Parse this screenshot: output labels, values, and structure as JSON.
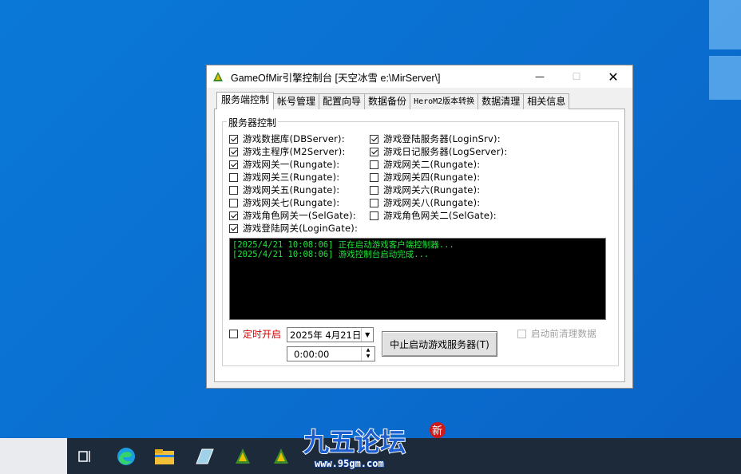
{
  "window": {
    "title": "GameOfMir引擎控制台 [天空冰雪 e:\\MirServer\\]",
    "minimize": "—",
    "maximize": "☐",
    "close": "✕"
  },
  "tabs": [
    {
      "label": "服务端控制"
    },
    {
      "label": "帐号管理"
    },
    {
      "label": "配置向导"
    },
    {
      "label": "数据备份"
    },
    {
      "label": "HeroM2版本转换"
    },
    {
      "label": "数据清理"
    },
    {
      "label": "相关信息"
    }
  ],
  "group": {
    "title": "服务器控制"
  },
  "left_checks": [
    {
      "label": "游戏数据库(DBServer):",
      "checked": true
    },
    {
      "label": "游戏主程序(M2Server):",
      "checked": true
    },
    {
      "label": "游戏网关一(Rungate):",
      "checked": true
    },
    {
      "label": "游戏网关三(Rungate):",
      "checked": false
    },
    {
      "label": "游戏网关五(Rungate):",
      "checked": false
    },
    {
      "label": "游戏网关七(Rungate):",
      "checked": false
    },
    {
      "label": "游戏角色网关一(SelGate):",
      "checked": true
    },
    {
      "label": "游戏登陆网关(LoginGate):",
      "checked": true
    }
  ],
  "right_checks": [
    {
      "label": "游戏登陆服务器(LoginSrv):",
      "checked": true
    },
    {
      "label": "游戏日记服务器(LogServer):",
      "checked": true
    },
    {
      "label": "游戏网关二(Rungate):",
      "checked": false
    },
    {
      "label": "游戏网关四(Rungate):",
      "checked": false
    },
    {
      "label": "游戏网关六(Rungate):",
      "checked": false
    },
    {
      "label": "游戏网关八(Rungate):",
      "checked": false
    },
    {
      "label": "游戏角色网关二(SelGate):",
      "checked": false
    }
  ],
  "console": {
    "lines": [
      "[2025/4/21 10:08:06] 正在启动游戏客户端控制器...",
      "[2025/4/21 10:08:06] 游戏控制台启动完成..."
    ]
  },
  "timer": {
    "label": "定时开启",
    "checked": false,
    "date": "2025年 4月21日",
    "time": "0:00:00"
  },
  "main_button": {
    "label": "中止启动游戏服务器(T)"
  },
  "clean_before_start": {
    "label": "启动前清理数据",
    "checked": false,
    "disabled": true
  },
  "watermark": {
    "text": "九五论坛",
    "url": "www.95gm.com",
    "badge": "新"
  },
  "colors": {
    "desktop": "#0a74d4",
    "console_bg": "#000000",
    "console_text": "#1fe63a",
    "timer_label": "#d40000"
  }
}
